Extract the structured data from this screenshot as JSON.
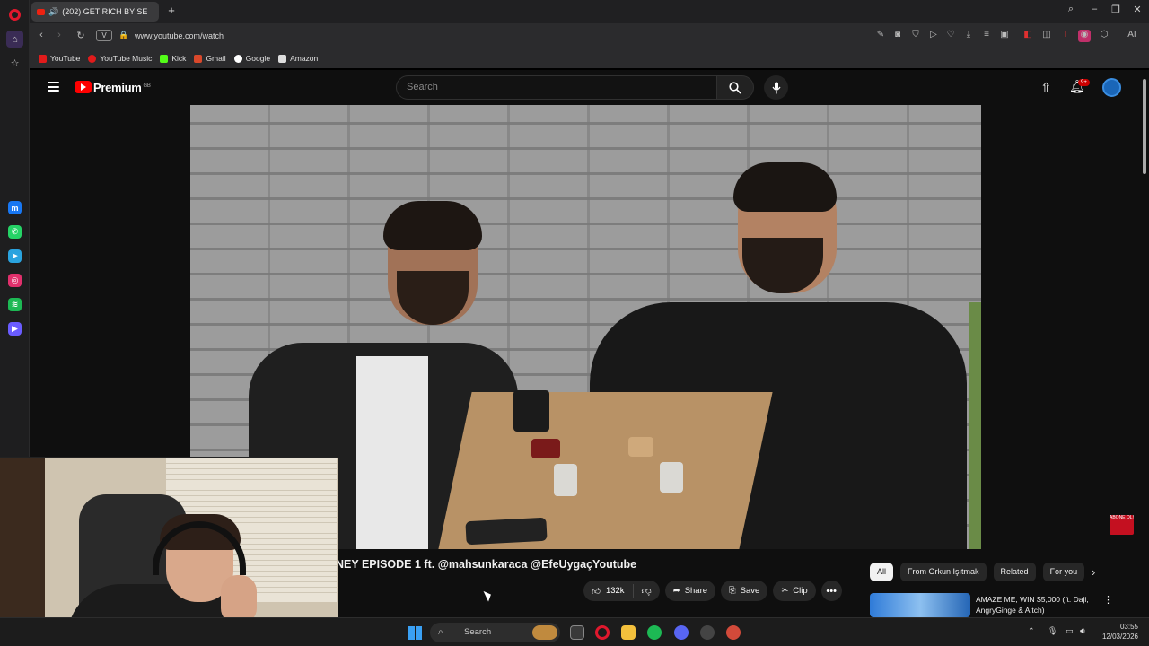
{
  "browser": {
    "tab_title": "(202) GET RICH BY SE",
    "new_tab_symbol": "+",
    "url": "www.youtube.com/watch",
    "view_button": "V",
    "ai_label": "AI",
    "bookmarks": [
      {
        "label": "YouTube",
        "color": "#e21b1b"
      },
      {
        "label": "YouTube Music",
        "color": "#e21b1b"
      },
      {
        "label": "Kick",
        "color": "#53fc18"
      },
      {
        "label": "Gmail",
        "color": "#d9482b"
      },
      {
        "label": "Google",
        "color": "#4285f4"
      },
      {
        "label": "Amazon",
        "color": "#dddddd"
      }
    ],
    "side_apps": [
      {
        "name": "messenger-icon",
        "color": "#1877f2"
      },
      {
        "name": "whatsapp-icon",
        "color": "#25d366"
      },
      {
        "name": "telegram-icon",
        "color": "#2aa3df"
      },
      {
        "name": "instagram-icon",
        "color": "#e1306c"
      },
      {
        "name": "spotify-icon",
        "color": "#1db954"
      },
      {
        "name": "player-icon",
        "color": "#6a5cff"
      }
    ]
  },
  "youtube": {
    "brand": "Premium",
    "brand_sup": "GB",
    "search_placeholder": "Search",
    "notification_count": "9+",
    "video_title": "NEY EPISODE 1 ft. @mahsunkaraca @EfeUygaçYoutube",
    "watermark": "ABONE OL!",
    "actions": {
      "likes": "132k",
      "share": "Share",
      "save": "Save",
      "clip": "Clip"
    },
    "chips": [
      "All",
      "From Orkun Işıtmak",
      "Related",
      "For you"
    ],
    "recommendation": {
      "title": "AMAZE ME, WIN $5,000 (ft. Daji, AngryGinge & Aitch)"
    }
  },
  "taskbar": {
    "search_label": "Search",
    "time": "03:55",
    "date": "12/03/2026"
  }
}
